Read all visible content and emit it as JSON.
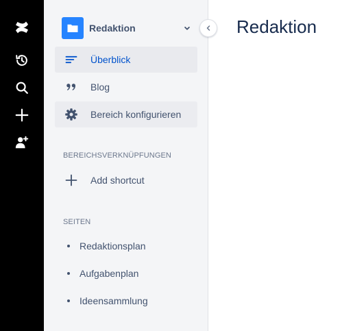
{
  "global_nav": {
    "logo_icon": "confluence-logo-icon",
    "items": [
      {
        "name": "recent-icon"
      },
      {
        "name": "search-icon"
      },
      {
        "name": "create-icon"
      },
      {
        "name": "invite-people-icon"
      }
    ]
  },
  "space": {
    "name": "Redaktion",
    "avatar_color": "#2684ff",
    "icon": "folder-icon"
  },
  "sidebar": {
    "nav": [
      {
        "label": "Überblick",
        "icon": "overview-icon",
        "selected": true
      },
      {
        "label": "Blog",
        "icon": "quote-icon"
      },
      {
        "label": "Bereich konfigurieren",
        "icon": "gear-icon"
      }
    ],
    "shortcuts_heading": "BEREICHSVERKNÜPFUNGEN",
    "add_shortcut": "Add shortcut",
    "pages_heading": "SEITEN",
    "pages": [
      "Redaktionsplan",
      "Aufgabenplan",
      "Ideensammlung"
    ]
  },
  "main": {
    "title": "Redaktion"
  },
  "colors": {
    "accent": "#0052cc",
    "sidebar_bg": "#f4f5f7",
    "text": "#42526e"
  }
}
